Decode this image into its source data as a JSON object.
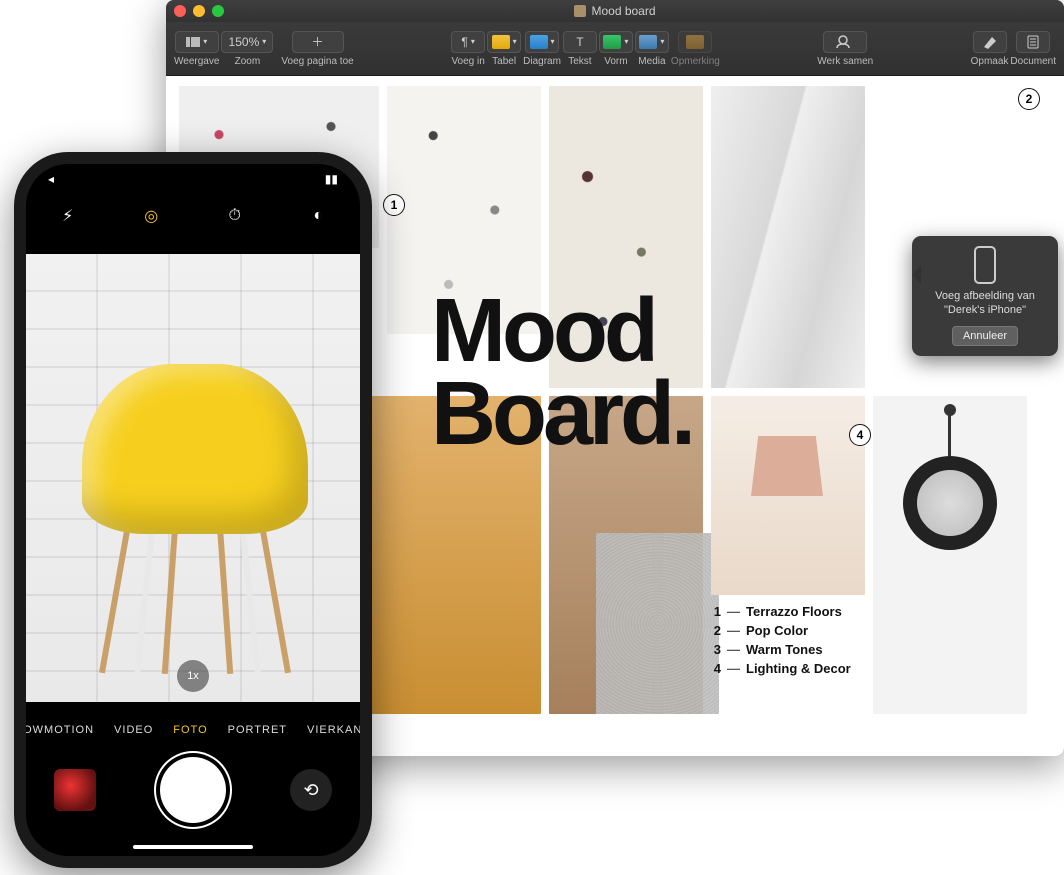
{
  "window": {
    "title": "Mood board"
  },
  "toolbar": {
    "view": "Weergave",
    "zoom_label": "Zoom",
    "zoom_value": "150%",
    "add_page": "Voeg pagina toe",
    "insert": "Voeg in",
    "table": "Tabel",
    "chart": "Diagram",
    "text": "Tekst",
    "shape": "Vorm",
    "media": "Media",
    "comment": "Opmerking",
    "collaborate": "Werk samen",
    "format": "Opmaak",
    "document": "Document"
  },
  "document": {
    "headline_l1": "Mood",
    "headline_l2": "Board.",
    "callouts": {
      "c1": "1",
      "c2": "2",
      "c4": "4"
    },
    "legend": [
      {
        "n": "1",
        "label": "Terrazzo Floors"
      },
      {
        "n": "2",
        "label": "Pop Color"
      },
      {
        "n": "3",
        "label": "Warm Tones"
      },
      {
        "n": "4",
        "label": "Lighting & Decor"
      }
    ]
  },
  "popover": {
    "line1": "Voeg afbeelding van",
    "line2": "\"Derek's iPhone\"",
    "cancel": "Annuleer"
  },
  "iphone": {
    "flash_icon": "flash-icon",
    "live_icon": "live-photo-icon",
    "timer_icon": "timer-icon",
    "filters_icon": "filters-icon",
    "zoom_badge": "1x",
    "modes": {
      "slowmo": "LOWMOTION",
      "video": "VIDEO",
      "photo": "FOTO",
      "portrait": "PORTRET",
      "square": "VIERKANT"
    }
  }
}
